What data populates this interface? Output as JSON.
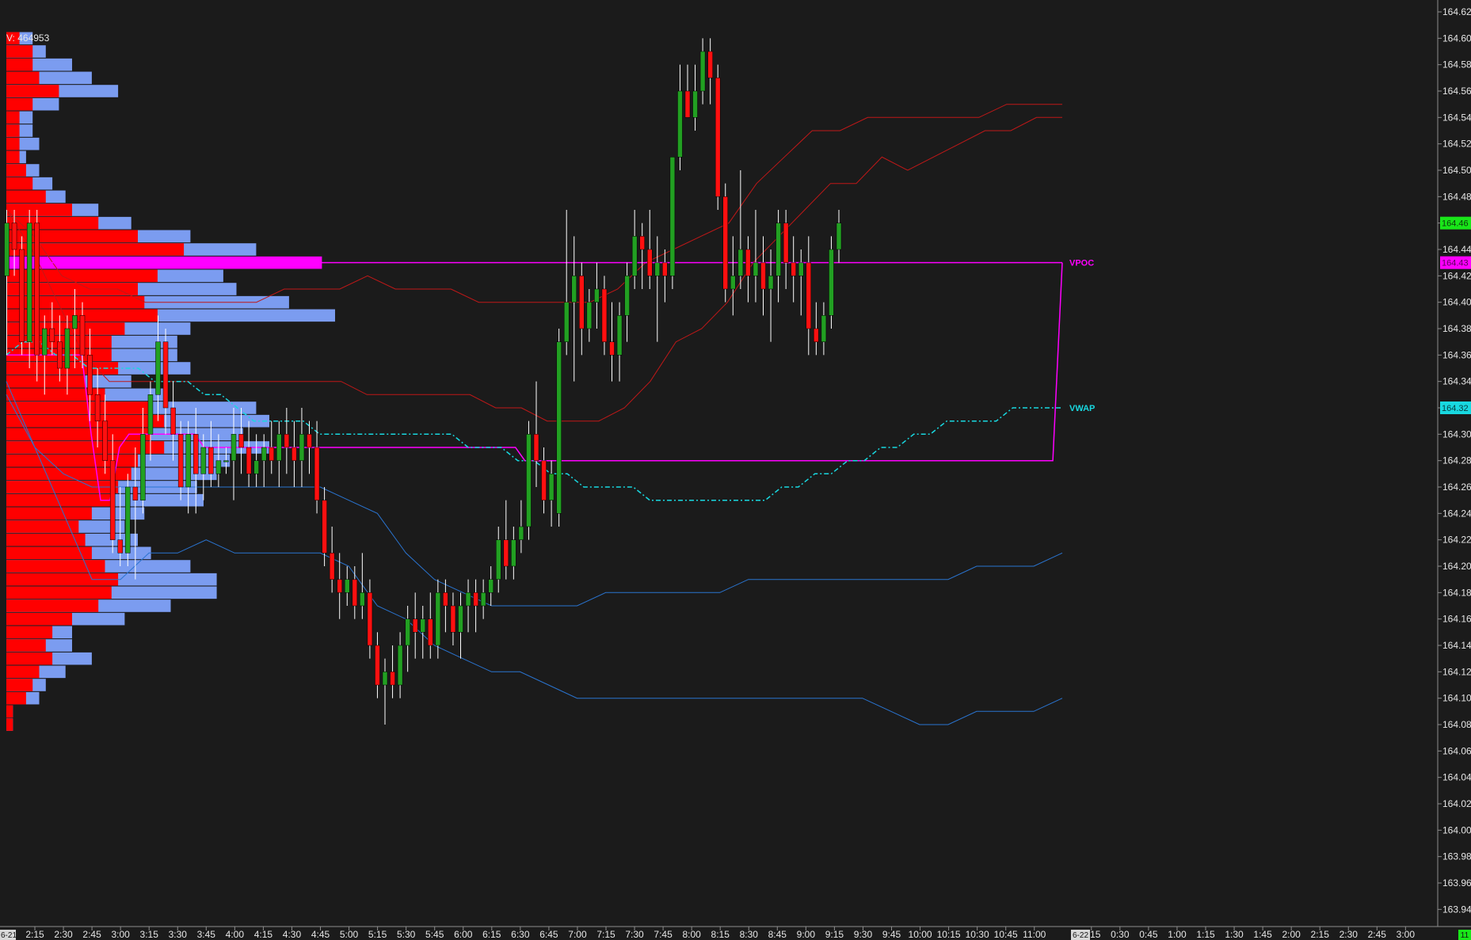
{
  "header": {
    "volume_label": "V: 464953"
  },
  "colors": {
    "background": "#1b1b1b",
    "up_candle": "#22a022",
    "down_candle": "#ff1010",
    "wick": "#ffffff",
    "profile_blue": "#7b9cf0",
    "profile_red": "#ff0000",
    "vpoc": "#ff00ff",
    "vwap": "#18d8e0",
    "band_upper": "#c01818",
    "band_lower": "#2a74d0",
    "last_price": "#19e619"
  },
  "chart_data": {
    "type": "candlestick",
    "title": "",
    "xlabel": "",
    "ylabel": "",
    "ylim": [
      163.92,
      164.63
    ],
    "y_ticks": [
      "164.62",
      "164.60",
      "164.58",
      "164.56",
      "164.54",
      "164.52",
      "164.50",
      "164.48",
      "164.46",
      "164.44",
      "164.42",
      "164.40",
      "164.38",
      "164.36",
      "164.34",
      "164.32",
      "164.30",
      "164.28",
      "164.26",
      "164.24",
      "164.22",
      "164.20",
      "164.18",
      "164.16",
      "164.14",
      "164.12",
      "164.10",
      "164.08",
      "164.06",
      "164.04",
      "164.02",
      "164.00",
      "163.98",
      "163.96",
      "163.94"
    ],
    "x_ticks": [
      "2:15",
      "2:30",
      "2:45",
      "3:00",
      "3:15",
      "3:30",
      "3:45",
      "4:00",
      "4:15",
      "4:30",
      "4:45",
      "5:00",
      "5:15",
      "5:30",
      "5:45",
      "6:00",
      "6:15",
      "6:30",
      "6:45",
      "7:00",
      "7:15",
      "7:30",
      "7:45",
      "8:00",
      "8:15",
      "8:30",
      "8:45",
      "9:00",
      "9:15",
      "9:30",
      "9:45",
      "10:00",
      "10:15",
      "10:30",
      "10:45",
      "11:00",
      "0:15",
      "0:30",
      "0:45",
      "1:00",
      "1:15",
      "1:30",
      "1:45",
      "2:00",
      "2:15",
      "2:30",
      "2:45",
      "3:00"
    ],
    "x_start_label": "6-21",
    "session_break_label": "6-22",
    "corner_label": "11",
    "last_price": {
      "value": 164.46,
      "label": "164.46"
    },
    "vpoc": {
      "value": 164.43,
      "label": "164.43",
      "name": "VPOC"
    },
    "vwap": {
      "value": 164.32,
      "label": "164.32",
      "name": "VWAP"
    },
    "candles_ohlc": [
      [
        164.42,
        164.47,
        164.36,
        164.46
      ],
      [
        164.46,
        164.47,
        164.42,
        164.44
      ],
      [
        164.44,
        164.45,
        164.36,
        164.37
      ],
      [
        164.37,
        164.47,
        164.35,
        164.46
      ],
      [
        164.46,
        164.47,
        164.34,
        164.36
      ],
      [
        164.36,
        164.39,
        164.33,
        164.38
      ],
      [
        164.38,
        164.4,
        164.36,
        164.37
      ],
      [
        164.37,
        164.39,
        164.34,
        164.35
      ],
      [
        164.35,
        164.39,
        164.33,
        164.38
      ],
      [
        164.38,
        164.41,
        164.35,
        164.39
      ],
      [
        164.39,
        164.4,
        164.35,
        164.36
      ],
      [
        164.36,
        164.38,
        164.31,
        164.33
      ],
      [
        164.33,
        164.35,
        164.29,
        164.31
      ],
      [
        164.31,
        164.33,
        164.27,
        164.28
      ],
      [
        164.28,
        164.3,
        164.21,
        164.22
      ],
      [
        164.22,
        164.26,
        164.2,
        164.21
      ],
      [
        164.21,
        164.27,
        164.2,
        164.26
      ],
      [
        164.26,
        164.29,
        164.19,
        164.25
      ],
      [
        164.25,
        164.32,
        164.24,
        164.3
      ],
      [
        164.3,
        164.34,
        164.28,
        164.33
      ],
      [
        164.33,
        164.39,
        164.31,
        164.37
      ],
      [
        164.37,
        164.38,
        164.3,
        164.32
      ],
      [
        164.32,
        164.34,
        164.28,
        164.3
      ],
      [
        164.3,
        164.31,
        164.25,
        164.26
      ],
      [
        164.26,
        164.31,
        164.24,
        164.3
      ],
      [
        164.3,
        164.32,
        164.24,
        164.27
      ],
      [
        164.27,
        164.3,
        164.25,
        164.29
      ],
      [
        164.29,
        164.31,
        164.26,
        164.27
      ],
      [
        164.27,
        164.3,
        164.26,
        164.28
      ],
      [
        164.28,
        164.29,
        164.27,
        164.28
      ],
      [
        164.28,
        164.32,
        164.25,
        164.3
      ],
      [
        164.3,
        164.32,
        164.27,
        164.29
      ],
      [
        164.29,
        164.31,
        164.26,
        164.27
      ],
      [
        164.27,
        164.3,
        164.26,
        164.28
      ],
      [
        164.28,
        164.3,
        164.26,
        164.29
      ],
      [
        164.29,
        164.31,
        164.27,
        164.28
      ],
      [
        164.28,
        164.31,
        164.26,
        164.3
      ],
      [
        164.3,
        164.32,
        164.27,
        164.29
      ],
      [
        164.29,
        164.31,
        164.26,
        164.28
      ],
      [
        164.28,
        164.32,
        164.26,
        164.3
      ],
      [
        164.3,
        164.31,
        164.27,
        164.29
      ],
      [
        164.29,
        164.31,
        164.24,
        164.25
      ],
      [
        164.25,
        164.26,
        164.2,
        164.21
      ],
      [
        164.21,
        164.23,
        164.18,
        164.19
      ],
      [
        164.19,
        164.21,
        164.16,
        164.18
      ],
      [
        164.18,
        164.2,
        164.17,
        164.19
      ],
      [
        164.19,
        164.2,
        164.16,
        164.17
      ],
      [
        164.17,
        164.21,
        164.16,
        164.18
      ],
      [
        164.18,
        164.19,
        164.13,
        164.14
      ],
      [
        164.14,
        164.15,
        164.1,
        164.11
      ],
      [
        164.11,
        164.13,
        164.08,
        164.12
      ],
      [
        164.12,
        164.14,
        164.1,
        164.11
      ],
      [
        164.11,
        164.15,
        164.1,
        164.14
      ],
      [
        164.14,
        164.17,
        164.12,
        164.16
      ],
      [
        164.16,
        164.18,
        164.13,
        164.15
      ],
      [
        164.15,
        164.17,
        164.13,
        164.16
      ],
      [
        164.16,
        164.18,
        164.13,
        164.14
      ],
      [
        164.14,
        164.19,
        164.13,
        164.18
      ],
      [
        164.18,
        164.19,
        164.15,
        164.17
      ],
      [
        164.17,
        164.18,
        164.14,
        164.15
      ],
      [
        164.15,
        164.18,
        164.13,
        164.17
      ],
      [
        164.17,
        164.19,
        164.15,
        164.18
      ],
      [
        164.18,
        164.19,
        164.15,
        164.17
      ],
      [
        164.17,
        164.19,
        164.16,
        164.18
      ],
      [
        164.18,
        164.2,
        164.17,
        164.19
      ],
      [
        164.19,
        164.23,
        164.18,
        164.22
      ],
      [
        164.22,
        164.25,
        164.19,
        164.2
      ],
      [
        164.2,
        164.23,
        164.19,
        164.22
      ],
      [
        164.22,
        164.25,
        164.21,
        164.23
      ],
      [
        164.23,
        164.31,
        164.22,
        164.3
      ],
      [
        164.3,
        164.34,
        164.26,
        164.28
      ],
      [
        164.28,
        164.29,
        164.24,
        164.25
      ],
      [
        164.25,
        164.28,
        164.23,
        164.27
      ],
      [
        164.24,
        164.38,
        164.23,
        164.37
      ],
      [
        164.37,
        164.47,
        164.36,
        164.4
      ],
      [
        164.4,
        164.45,
        164.34,
        164.42
      ],
      [
        164.42,
        164.43,
        164.36,
        164.38
      ],
      [
        164.38,
        164.41,
        164.37,
        164.4
      ],
      [
        164.4,
        164.43,
        164.38,
        164.41
      ],
      [
        164.41,
        164.42,
        164.36,
        164.37
      ],
      [
        164.37,
        164.4,
        164.34,
        164.36
      ],
      [
        164.36,
        164.4,
        164.34,
        164.39
      ],
      [
        164.39,
        164.43,
        164.37,
        164.42
      ],
      [
        164.42,
        164.47,
        164.41,
        164.45
      ],
      [
        164.45,
        164.46,
        164.41,
        164.44
      ],
      [
        164.44,
        164.47,
        164.41,
        164.42
      ],
      [
        164.42,
        164.45,
        164.37,
        164.43
      ],
      [
        164.43,
        164.44,
        164.4,
        164.42
      ],
      [
        164.42,
        164.5,
        164.41,
        164.51
      ],
      [
        164.51,
        164.58,
        164.5,
        164.56
      ],
      [
        164.56,
        164.58,
        164.54,
        164.54
      ],
      [
        164.54,
        164.58,
        164.53,
        164.56
      ],
      [
        164.56,
        164.6,
        164.55,
        164.59
      ],
      [
        164.59,
        164.6,
        164.55,
        164.57
      ],
      [
        164.57,
        164.58,
        164.47,
        164.48
      ],
      [
        164.48,
        164.49,
        164.4,
        164.41
      ],
      [
        164.41,
        164.45,
        164.39,
        164.42
      ],
      [
        164.42,
        164.5,
        164.41,
        164.44
      ],
      [
        164.44,
        164.45,
        164.4,
        164.42
      ],
      [
        164.42,
        164.47,
        164.4,
        164.43
      ],
      [
        164.43,
        164.45,
        164.39,
        164.41
      ],
      [
        164.41,
        164.44,
        164.37,
        164.42
      ],
      [
        164.42,
        164.47,
        164.4,
        164.46
      ],
      [
        164.46,
        164.47,
        164.41,
        164.43
      ],
      [
        164.43,
        164.45,
        164.4,
        164.42
      ],
      [
        164.42,
        164.44,
        164.39,
        164.43
      ],
      [
        164.43,
        164.45,
        164.36,
        164.38
      ],
      [
        164.38,
        164.4,
        164.36,
        164.37
      ],
      [
        164.37,
        164.4,
        164.36,
        164.39
      ],
      [
        164.39,
        164.45,
        164.38,
        164.44
      ],
      [
        164.44,
        164.47,
        164.43,
        164.46
      ]
    ],
    "vwap_series": [
      164.36,
      164.37,
      164.37,
      164.36,
      164.36,
      164.35,
      164.35,
      164.35,
      164.35,
      164.34,
      164.34,
      164.34,
      164.33,
      164.33,
      164.32,
      164.31,
      164.31,
      164.31,
      164.31,
      164.3,
      164.3,
      164.3,
      164.3,
      164.3,
      164.3,
      164.3,
      164.3,
      164.3,
      164.29,
      164.29,
      164.29,
      164.28,
      164.28,
      164.27,
      164.27,
      164.26,
      164.26,
      164.26,
      164.26,
      164.25,
      164.25,
      164.25,
      164.25,
      164.25,
      164.25,
      164.25,
      164.25,
      164.26,
      164.26,
      164.27,
      164.27,
      164.28,
      164.28,
      164.29,
      164.29,
      164.3,
      164.3,
      164.31,
      164.31,
      164.31,
      164.31,
      164.32,
      164.32,
      164.32,
      164.32
    ],
    "upper_band_series": [
      164.47,
      164.45,
      164.42,
      164.41,
      164.41,
      164.4,
      164.4,
      164.4,
      164.4,
      164.4,
      164.41,
      164.41,
      164.41,
      164.42,
      164.41,
      164.41,
      164.41,
      164.4,
      164.4,
      164.4,
      164.4,
      164.4,
      164.41,
      164.43,
      164.44,
      164.45,
      164.46,
      164.49,
      164.51,
      164.53,
      164.53,
      164.54,
      164.54,
      164.54,
      164.54,
      164.54,
      164.55,
      164.55,
      164.55
    ],
    "lower_band_series": [
      164.34,
      164.29,
      164.24,
      164.19,
      164.19,
      164.21,
      164.21,
      164.22,
      164.21,
      164.21,
      164.21,
      164.21,
      164.2,
      164.17,
      164.16,
      164.14,
      164.13,
      164.12,
      164.12,
      164.11,
      164.1,
      164.1,
      164.1,
      164.1,
      164.1,
      164.1,
      164.1,
      164.1,
      164.1,
      164.1,
      164.1,
      164.09,
      164.08,
      164.08,
      164.09,
      164.09,
      164.09,
      164.1
    ],
    "upper_band2_series": [
      164.47,
      164.44,
      164.4,
      164.36,
      164.34,
      164.34,
      164.34,
      164.34,
      164.34,
      164.34,
      164.34,
      164.34,
      164.34,
      164.34,
      164.33,
      164.33,
      164.33,
      164.33,
      164.33,
      164.32,
      164.32,
      164.31,
      164.31,
      164.31,
      164.32,
      164.34,
      164.37,
      164.38,
      164.4,
      164.43,
      164.45,
      164.47,
      164.49,
      164.49,
      164.51,
      164.5,
      164.51,
      164.52,
      164.53,
      164.53,
      164.54,
      164.54
    ],
    "lower_band2_series": [
      164.33,
      164.29,
      164.27,
      164.26,
      164.26,
      164.26,
      164.26,
      164.26,
      164.26,
      164.26,
      164.26,
      164.26,
      164.25,
      164.24,
      164.21,
      164.19,
      164.18,
      164.17,
      164.17,
      164.17,
      164.17,
      164.18,
      164.18,
      164.18,
      164.18,
      164.18,
      164.19,
      164.19,
      164.19,
      164.19,
      164.19,
      164.19,
      164.19,
      164.19,
      164.2,
      164.2,
      164.2,
      164.21
    ],
    "developing_poc_series": [
      164.36,
      164.36,
      164.36,
      164.36,
      164.36,
      164.36,
      164.36,
      164.36,
      164.36,
      164.3,
      164.25,
      164.25,
      164.29,
      164.3,
      164.3,
      164.3,
      164.3,
      164.3,
      164.3,
      164.3,
      164.3,
      164.29,
      164.29,
      164.29,
      164.29,
      164.29,
      164.29,
      164.29,
      164.29,
      164.29,
      164.29,
      164.29,
      164.29,
      164.29,
      164.29,
      164.29,
      164.29,
      164.29,
      164.29,
      164.29,
      164.29,
      164.29,
      164.29,
      164.29,
      164.29,
      164.29,
      164.29,
      164.29,
      164.29,
      164.29,
      164.29,
      164.29,
      164.29,
      164.29,
      164.29,
      164.28,
      164.28,
      164.28,
      164.28,
      164.28,
      164.28,
      164.28,
      164.28,
      164.28,
      164.28,
      164.28,
      164.28,
      164.28,
      164.28,
      164.28,
      164.28,
      164.28,
      164.28,
      164.28,
      164.28,
      164.28,
      164.28,
      164.28,
      164.28,
      164.28,
      164.28,
      164.28,
      164.28,
      164.28,
      164.28,
      164.28,
      164.28,
      164.28,
      164.28,
      164.28,
      164.28,
      164.28,
      164.28,
      164.28,
      164.28,
      164.28,
      164.28,
      164.28,
      164.28,
      164.28,
      164.28,
      164.28,
      164.28,
      164.28,
      164.28,
      164.28,
      164.28,
      164.28,
      164.28,
      164.28,
      164.28,
      164.28,
      164.43
    ],
    "volume_profile": {
      "price_levels": [
        164.6,
        164.59,
        164.58,
        164.57,
        164.56,
        164.55,
        164.54,
        164.53,
        164.52,
        164.51,
        164.5,
        164.49,
        164.48,
        164.47,
        164.46,
        164.45,
        164.44,
        164.43,
        164.42,
        164.41,
        164.4,
        164.39,
        164.38,
        164.37,
        164.36,
        164.35,
        164.34,
        164.33,
        164.32,
        164.31,
        164.3,
        164.29,
        164.28,
        164.27,
        164.26,
        164.25,
        164.24,
        164.23,
        164.22,
        164.21,
        164.2,
        164.19,
        164.18,
        164.17,
        164.16,
        164.15,
        164.14,
        164.13,
        164.12,
        164.11,
        164.1,
        164.09,
        164.08
      ],
      "total": [
        4,
        6,
        10,
        13,
        17,
        8,
        4,
        4,
        5,
        3,
        5,
        7,
        9,
        14,
        19,
        28,
        38,
        48,
        33,
        35,
        43,
        50,
        28,
        26,
        26,
        28,
        19,
        24,
        38,
        40,
        36,
        40,
        34,
        32,
        29,
        30,
        21,
        18,
        20,
        22,
        28,
        32,
        32,
        25,
        18,
        10,
        10,
        13,
        9,
        6,
        5,
        1,
        1
      ],
      "sell": [
        2,
        4,
        4,
        5,
        8,
        4,
        2,
        2,
        2,
        2,
        3,
        4,
        6,
        10,
        14,
        20,
        27,
        48,
        23,
        20,
        21,
        23,
        18,
        16,
        16,
        17,
        12,
        15,
        22,
        24,
        22,
        24,
        20,
        19,
        17,
        16,
        13,
        11,
        12,
        13,
        15,
        17,
        16,
        14,
        10,
        7,
        6,
        7,
        5,
        4,
        3,
        1,
        1
      ]
    }
  }
}
